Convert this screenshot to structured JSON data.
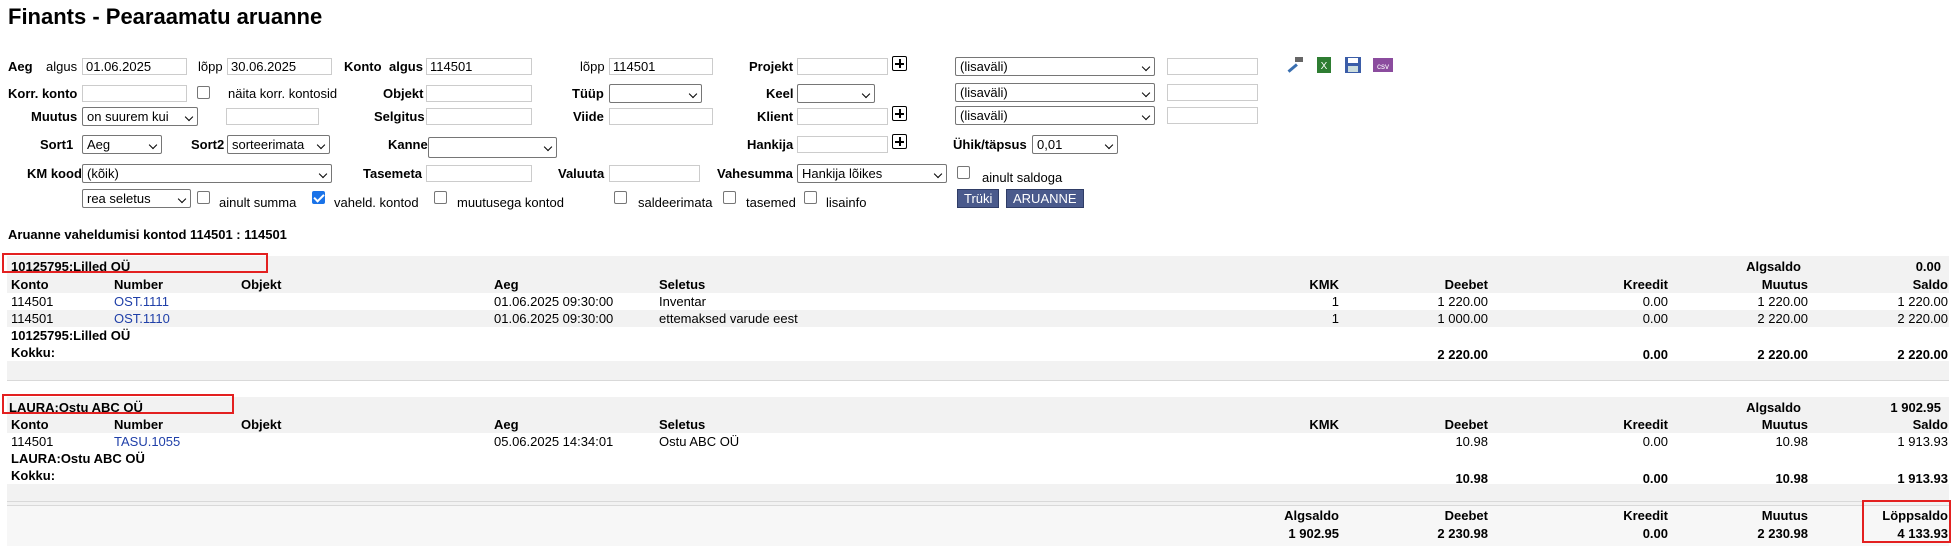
{
  "page": {
    "title": "Finants - Pearaamatu aruanne"
  },
  "filters": {
    "aeg_label": "Aeg",
    "algus_label": "algus",
    "algus_value": "01.06.2025",
    "lopp_label": "lõpp",
    "lopp_value": "30.06.2025",
    "konto_label": "Konto",
    "konto_algus_label": "algus",
    "konto_algus_value": "114501",
    "konto_lopp_label": "lõpp",
    "konto_lopp_value": "114501",
    "projekt_label": "Projekt",
    "lisavali": "(lisaväli)",
    "korr_konto_label": "Korr. konto",
    "naita_korr_label": "näita korr. kontosid",
    "objekt_label": "Objekt",
    "tuup_label": "Tüüp",
    "keel_label": "Keel",
    "muutus_label": "Muutus",
    "muutus_value": "on suurem kui",
    "selgitus_label": "Selgitus",
    "viide_label": "Viide",
    "klient_label": "Klient",
    "sort1_label": "Sort1",
    "sort1_value": "Aeg",
    "sort2_label": "Sort2",
    "sort2_value": "sorteerimata",
    "kanne_label": "Kanne",
    "hankija_label": "Hankija",
    "uhik_label": "Ühik/täpsus",
    "uhik_value": "0,01",
    "km_kood_label": "KM kood",
    "km_kood_value": "(kõik)",
    "tasemeta_label": "Tasemeta",
    "valuuta_label": "Valuuta",
    "vahesumma_label": "Vahesumma",
    "vahesumma_value": "Hankija lõikes",
    "ainult_saldoga_label": "ainult saldoga",
    "rea_seletus_value": "rea seletus",
    "ainult_summa_label": "ainult summa",
    "vaheld_kontod_label": "vaheld. kontod",
    "muutusega_kontod_label": "muutusega kontod",
    "saldeerimata_label": "saldeerimata",
    "tasemed_label": "tasemed",
    "lisainfo_label": "lisainfo",
    "truki_label": "Trüki",
    "aruanne_label": "ARUANNE"
  },
  "report": {
    "subtitle": "Aruanne vaheldumisi kontod 114501 : 114501",
    "headers": {
      "konto": "Konto",
      "number": "Number",
      "objekt": "Objekt",
      "aeg": "Aeg",
      "seletus": "Seletus",
      "kmk": "KMK",
      "deebet": "Deebet",
      "kreedit": "Kreedit",
      "muutus": "Muutus",
      "saldo": "Saldo",
      "algsaldo": "Algsaldo"
    },
    "kokku_label": "Kokku:",
    "groups": [
      {
        "name": "10125795:Lilled OÜ",
        "algsaldo": "0.00",
        "rows": [
          {
            "konto": "114501",
            "number": "OST.1111",
            "objekt": "",
            "aeg": "01.06.2025 09:30:00",
            "seletus": "Inventar",
            "kmk": "1",
            "deebet": "1 220.00",
            "kreedit": "0.00",
            "muutus": "1 220.00",
            "saldo": "1 220.00"
          },
          {
            "konto": "114501",
            "number": "OST.1110",
            "objekt": "",
            "aeg": "01.06.2025 09:30:00",
            "seletus": "ettemaksed varude eest",
            "kmk": "1",
            "deebet": "1 000.00",
            "kreedit": "0.00",
            "muutus": "2 220.00",
            "saldo": "2 220.00"
          }
        ],
        "total": {
          "deebet": "2 220.00",
          "kreedit": "0.00",
          "muutus": "2 220.00",
          "saldo": "2 220.00"
        }
      },
      {
        "name": "LAURA:Ostu ABC OÜ",
        "algsaldo": "1 902.95",
        "rows": [
          {
            "konto": "114501",
            "number": "TASU.1055",
            "objekt": "",
            "aeg": "05.06.2025 14:34:01",
            "seletus": "Ostu ABC OÜ",
            "kmk": "",
            "deebet": "10.98",
            "kreedit": "0.00",
            "muutus": "10.98",
            "saldo": "1 913.93"
          }
        ],
        "total": {
          "deebet": "10.98",
          "kreedit": "0.00",
          "muutus": "10.98",
          "saldo": "1 913.93"
        }
      }
    ],
    "grand": {
      "algsaldo_label": "Algsaldo",
      "deebet_label": "Deebet",
      "kreedit_label": "Kreedit",
      "muutus_label": "Muutus",
      "loppsaldo_label": "Löppsaldo",
      "algsaldo": "1 902.95",
      "deebet": "2 230.98",
      "kreedit": "0.00",
      "muutus": "2 230.98",
      "loppsaldo": "4 133.93"
    }
  }
}
